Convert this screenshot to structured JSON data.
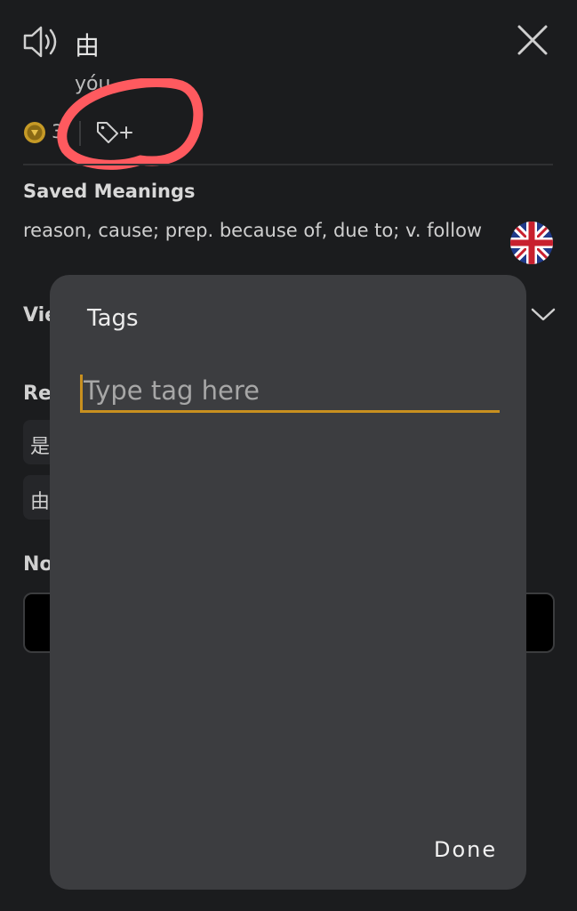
{
  "header": {
    "character": "由",
    "pinyin": "yóu",
    "level": "3"
  },
  "saved_meanings": {
    "title": "Saved Meanings",
    "text": "reason, cause; prep. because of, due to; v. follow"
  },
  "view_section": {
    "label": "Vie"
  },
  "related": {
    "title": "Re",
    "chips": [
      "是",
      "由"
    ]
  },
  "notes": {
    "title": "No"
  },
  "tags_dialog": {
    "title": "Tags",
    "placeholder": "Type tag here",
    "value": "",
    "done_label": "Done"
  },
  "colors": {
    "background": "#1b1c1e",
    "dialog": "#3c3d40",
    "accent": "#c8901f",
    "annotation": "#ff5a5f"
  },
  "icons": [
    "speaker-icon",
    "close-icon",
    "coin-icon",
    "tag-add-icon",
    "uk-flag-icon",
    "chevron-down-icon"
  ]
}
